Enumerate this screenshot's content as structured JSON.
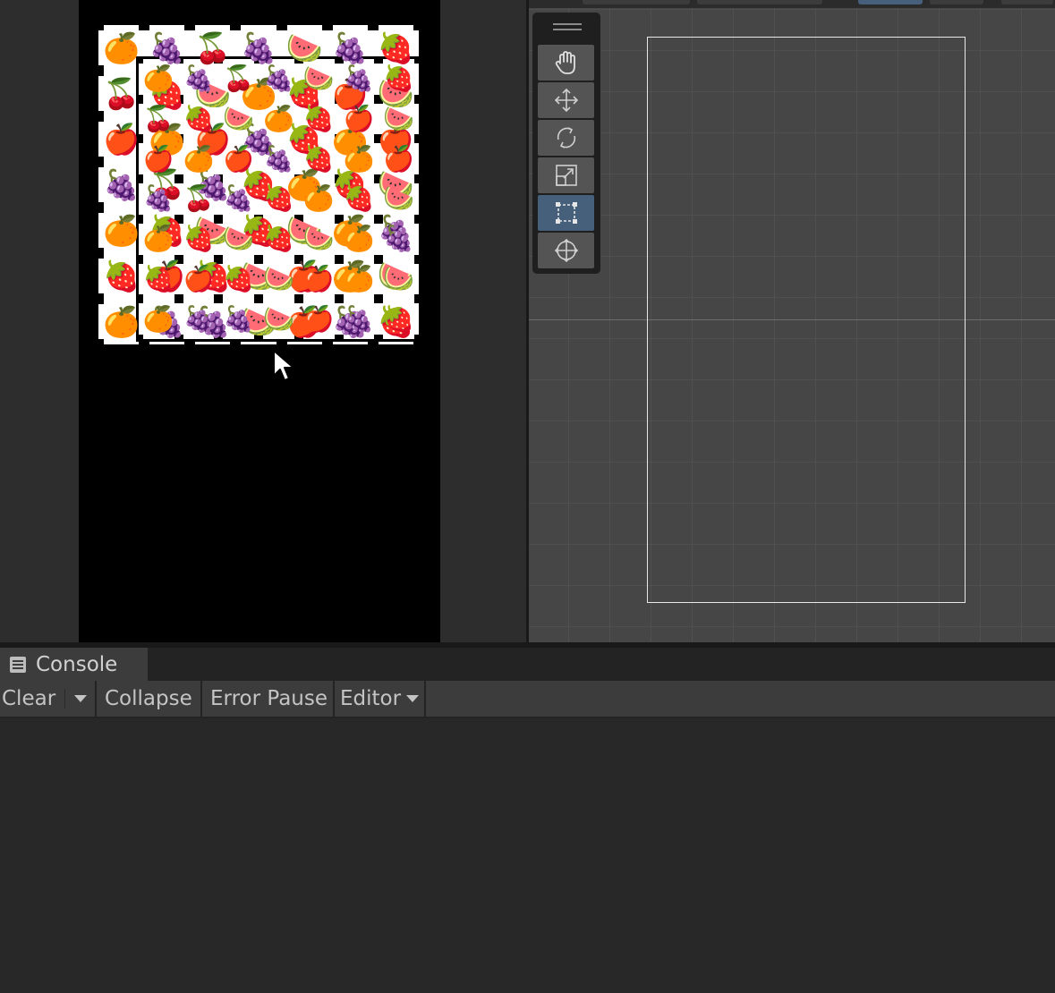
{
  "game_board": {
    "rows": [
      [
        "🍊",
        "🍇",
        "🍒",
        "🍇",
        "🍉",
        "🍇",
        "🍓"
      ],
      [
        "🍒",
        "🍓",
        "🍉",
        "🍊",
        "🍓",
        "🍎",
        "🍉"
      ],
      [
        "🍎",
        "🍊",
        "🍎",
        "🍇",
        "🍓",
        "🍊",
        "🍎"
      ],
      [
        "🍇",
        "🍒",
        "🍇",
        "🍓",
        "🍊",
        "🍓",
        "🍉"
      ],
      [
        "🍊",
        "🍓",
        "🍉",
        "🍓",
        "🍉",
        "🍊",
        "🍇"
      ],
      [
        "🍓",
        "🍎",
        "🍓",
        "🍉",
        "🍎",
        "🍊",
        "🍉"
      ],
      [
        "🍊",
        "🍇",
        "🍇",
        "🍉",
        "🍎",
        "🍇",
        "🍓"
      ]
    ]
  },
  "scene_board": {
    "rows": [
      [
        "🍊",
        "🍇",
        "🍒",
        "🍇",
        "🍉",
        "🍇",
        "🍓"
      ],
      [
        "🍒",
        "🍓",
        "🍉",
        "🍊",
        "🍓",
        "🍎",
        "🍉"
      ],
      [
        "🍎",
        "🍊",
        "🍎",
        "🍇",
        "🍓",
        "🍊",
        "🍎"
      ],
      [
        "🍇",
        "🍒",
        "🍇",
        "🍓",
        "🍊",
        "🍓",
        "🍉"
      ],
      [
        "🍊",
        "🍓",
        "🍉",
        "🍓",
        "🍉",
        "🍊",
        "🍇"
      ],
      [
        "🍓",
        "🍎",
        "🍓",
        "🍉",
        "🍎",
        "🍊",
        "🍉"
      ],
      [
        "🍊",
        "🍇",
        "🍇",
        "🍉",
        "🍎",
        "🍇",
        "🍓"
      ]
    ]
  },
  "tools": [
    {
      "name": "hand-tool",
      "icon": "hand-icon",
      "active": false
    },
    {
      "name": "move-tool",
      "icon": "move-arrows-icon",
      "active": false
    },
    {
      "name": "rotate-tool",
      "icon": "rotate-icon",
      "active": false
    },
    {
      "name": "scale-tool",
      "icon": "scale-icon",
      "active": false
    },
    {
      "name": "rect-tool",
      "icon": "rect-transform-icon",
      "active": true
    },
    {
      "name": "transform-tool",
      "icon": "transform-icon",
      "active": false
    }
  ],
  "console": {
    "tab_label": "Console",
    "tab_icon": "console-list-icon",
    "toolbar": {
      "clear_label": "Clear",
      "collapse_label": "Collapse",
      "error_pause_label": "Error Pause",
      "editor_label": "Editor"
    }
  },
  "colors": {
    "active_tool": "#46607c",
    "panel_bg": "#282828",
    "toolbar_bg": "#3c3c3c"
  }
}
